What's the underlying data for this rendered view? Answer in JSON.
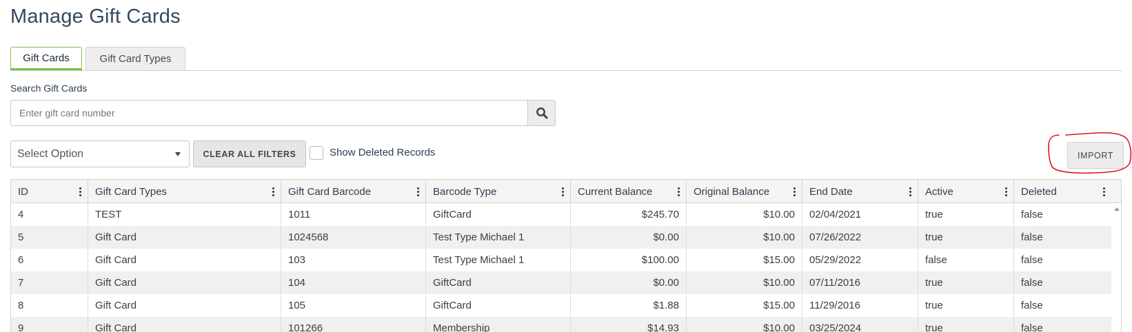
{
  "page": {
    "title": "Manage Gift Cards"
  },
  "tabs": [
    {
      "label": "Gift Cards",
      "active": true
    },
    {
      "label": "Gift Card Types",
      "active": false
    }
  ],
  "search": {
    "label": "Search Gift Cards",
    "placeholder": "Enter gift card number",
    "value": "",
    "icon": "search-icon"
  },
  "filters": {
    "select_value": "Select Option",
    "clear_label": "CLEAR ALL FILTERS",
    "show_deleted_label": "Show Deleted Records",
    "show_deleted_checked": false
  },
  "actions": {
    "import_label": "IMPORT"
  },
  "annotation": {
    "color": "#e0141e",
    "shape": "hand-drawn circle around import button"
  },
  "colors": {
    "accent": "#7cc242",
    "text": "#2c3e50",
    "header_bg": "#f4f4f4",
    "stripe_bg": "#f0f0f0"
  },
  "table": {
    "columns": [
      "ID",
      "Gift Card Types",
      "Gift Card Barcode",
      "Barcode Type",
      "Current Balance",
      "Original Balance",
      "End Date",
      "Active",
      "Deleted"
    ],
    "rows": [
      [
        "4",
        "TEST",
        "1011",
        "GiftCard",
        "$245.70",
        "$10.00",
        "02/04/2021",
        "true",
        "false"
      ],
      [
        "5",
        "Gift Card",
        "1024568",
        "Test Type Michael 1",
        "$0.00",
        "$10.00",
        "07/26/2022",
        "true",
        "false"
      ],
      [
        "6",
        "Gift Card",
        "103",
        "Test Type Michael 1",
        "$100.00",
        "$15.00",
        "05/29/2022",
        "false",
        "false"
      ],
      [
        "7",
        "Gift Card",
        "104",
        "GiftCard",
        "$0.00",
        "$10.00",
        "07/11/2016",
        "true",
        "false"
      ],
      [
        "8",
        "Gift Card",
        "105",
        "GiftCard",
        "$1.88",
        "$15.00",
        "11/29/2016",
        "true",
        "false"
      ],
      [
        "9",
        "Gift Card",
        "101266",
        "Membership",
        "$14.93",
        "$10.00",
        "03/25/2024",
        "true",
        "false"
      ]
    ]
  }
}
